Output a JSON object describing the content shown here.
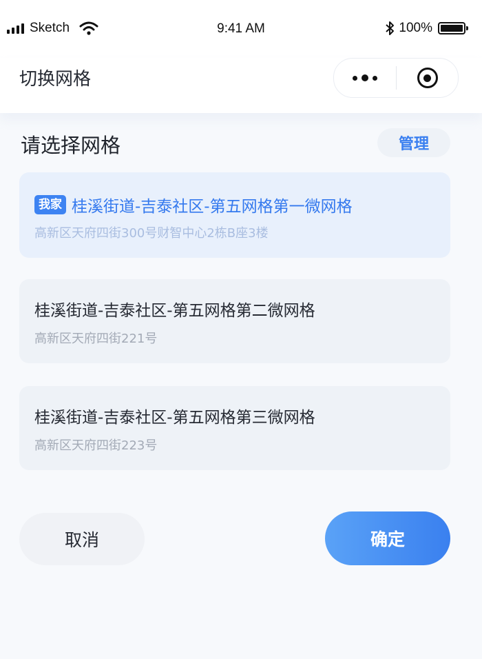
{
  "status_bar": {
    "carrier": "Sketch",
    "time": "9:41 AM",
    "battery_percent": "100%",
    "battery_level": 1.0,
    "icons": [
      "signal-icon",
      "wifi-icon",
      "bluetooth-icon",
      "battery-icon"
    ]
  },
  "nav": {
    "title": "切换网格",
    "capsule_icons": [
      "more-icon",
      "close-target-icon"
    ]
  },
  "section": {
    "title": "请选择网格",
    "manage_label": "管理"
  },
  "grids": [
    {
      "badge": "我家",
      "name": "桂溪街道-吉泰社区-第五网格第一微网格",
      "address": "高新区天府四街300号财智中心2栋B座3楼",
      "selected": true
    },
    {
      "name": "桂溪街道-吉泰社区-第五网格第二微网格",
      "address": "高新区天府四街221号",
      "selected": false
    },
    {
      "name": "桂溪街道-吉泰社区-第五网格第三微网格",
      "address": "高新区天府四街223号",
      "selected": false
    }
  ],
  "actions": {
    "cancel_label": "取消",
    "confirm_label": "确定"
  },
  "colors": {
    "accent": "#3a80ef",
    "selected_card_bg": "#e8f0fc",
    "card_bg": "#eef2f7"
  }
}
